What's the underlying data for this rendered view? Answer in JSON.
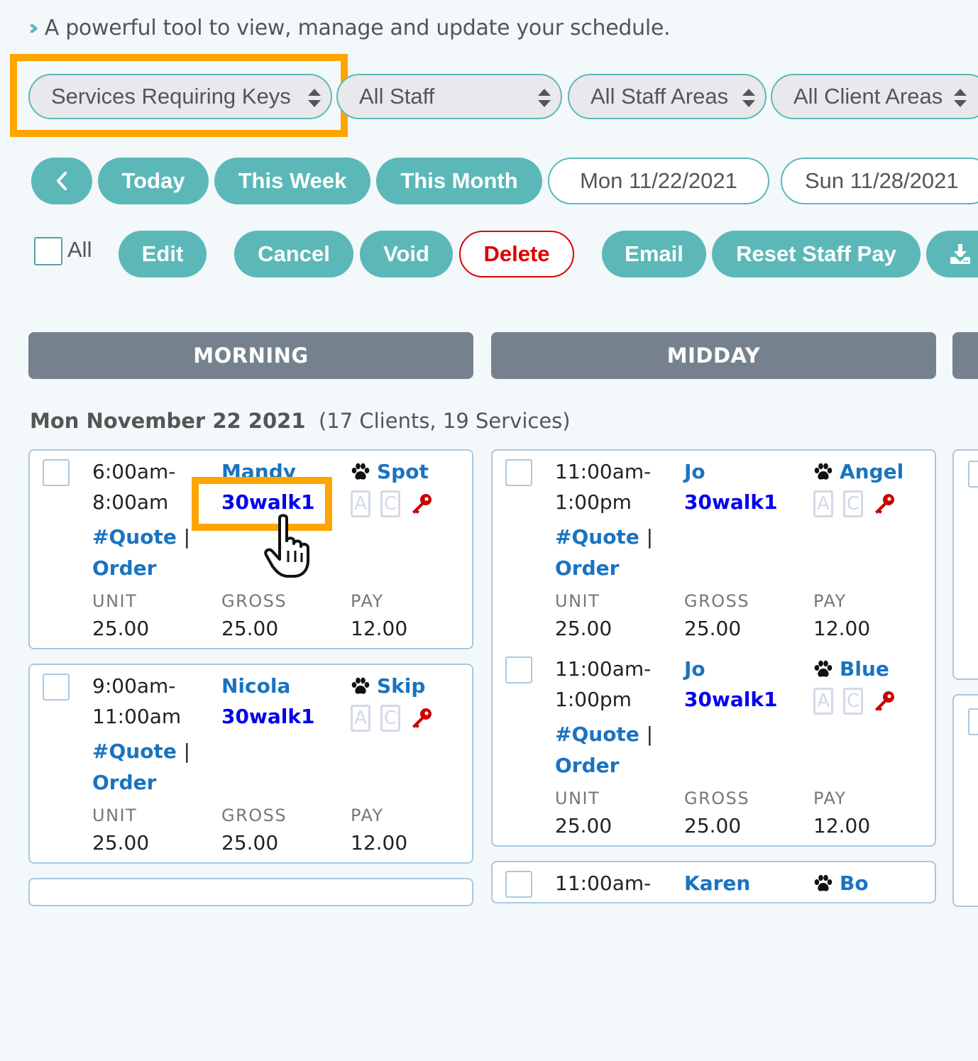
{
  "tagline": {
    "icon": "double-chevron-right-icon",
    "text": "A powerful tool to view, manage and update your schedule."
  },
  "filters": {
    "service_filter": "Services Requiring Keys",
    "staff_filter": "All Staff",
    "staff_area_filter": "All Staff Areas",
    "client_area_filter": "All Client Areas"
  },
  "date_nav": {
    "prev_icon": "chevron-left-icon",
    "today": "Today",
    "this_week": "This Week",
    "this_month": "This Month",
    "start_date": "Mon 11/22/2021",
    "end_date": "Sun 11/28/2021"
  },
  "actions": {
    "select_all_label": "All",
    "edit": "Edit",
    "cancel": "Cancel",
    "void": "Void",
    "delete": "Delete",
    "email": "Email",
    "reset_staff_pay": "Reset Staff Pay",
    "download_icon": "download-icon"
  },
  "sections": [
    "MORNING",
    "MIDDAY",
    ""
  ],
  "day": {
    "title": "Mon November 22 2021",
    "summary": "(17 Clients, 19 Services)"
  },
  "labels": {
    "unit": "UNIT",
    "gross": "GROSS",
    "pay": "PAY",
    "quote": "#Quote",
    "separator": "|",
    "order": "Order"
  },
  "morning_services": [
    {
      "time_start": "6:00am-",
      "time_end": "8:00am",
      "client": "Mandy",
      "service": "30walk1",
      "pet": "Spot",
      "badge_a": "A",
      "badge_c": "C",
      "unit": "25.00",
      "gross": "25.00",
      "pay": "12.00"
    },
    {
      "time_start": "9:00am-",
      "time_end": "11:00am",
      "client": "Nicola",
      "service": "30walk1",
      "pet": "Skip",
      "badge_a": "A",
      "badge_c": "C",
      "unit": "25.00",
      "gross": "25.00",
      "pay": "12.00"
    }
  ],
  "midday_services": [
    {
      "time_start": "11:00am-",
      "time_end": "1:00pm",
      "client": "Jo",
      "service": "30walk1",
      "pet": "Angel",
      "badge_a": "A",
      "badge_c": "C",
      "unit": "25.00",
      "gross": "25.00",
      "pay": "12.00"
    },
    {
      "time_start": "11:00am-",
      "time_end": "1:00pm",
      "client": "Jo",
      "service": "30walk1",
      "pet": "Blue",
      "badge_a": "A",
      "badge_c": "C",
      "unit": "25.00",
      "gross": "25.00",
      "pay": "12.00"
    },
    {
      "time_start": "11:00am-",
      "client": "Karen",
      "pet": "Bo"
    }
  ],
  "colors": {
    "accent": "#5cb8b8",
    "danger": "#dd0000",
    "highlight": "#ffa500",
    "link": "#1a73c0",
    "service_link": "#0000ee",
    "key": "#cc0000",
    "section_bar": "#75828e"
  }
}
